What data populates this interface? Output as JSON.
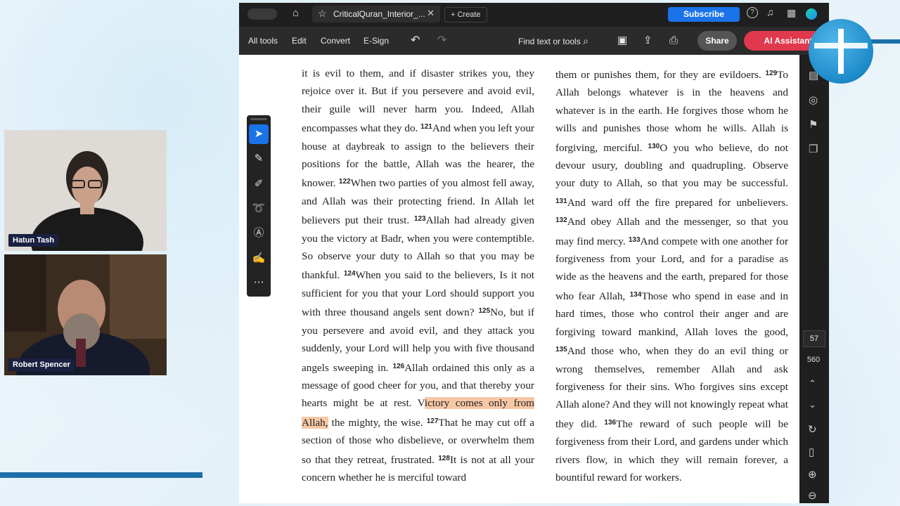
{
  "participants": [
    {
      "name": "Hatun Tash"
    },
    {
      "name": "Robert Spencer"
    }
  ],
  "titlebar": {
    "tab_title": "CriticalQuran_Interior_...",
    "create_label": "Create",
    "subscribe_label": "Subscribe"
  },
  "toolbar": {
    "all_tools": "All tools",
    "edit": "Edit",
    "convert": "Convert",
    "esign": "E-Sign",
    "find": "Find text or tools",
    "share": "Share",
    "ai_assistant": "AI Assistant"
  },
  "page_nav": {
    "current": "57",
    "total": "560"
  },
  "icons": [
    "home-icon",
    "star-icon",
    "close-icon",
    "plus-icon",
    "help-icon",
    "bell-icon",
    "apps-icon",
    "undo-icon",
    "redo-icon",
    "search-icon",
    "save-icon",
    "upload-icon",
    "print-icon",
    "select-icon",
    "comment-icon",
    "pen-icon",
    "lasso-icon",
    "text-select-icon",
    "stamp-icon",
    "more-icon",
    "refresh-icon",
    "zoom-in-icon",
    "zoom-out-icon",
    "chevron-up-icon",
    "chevron-down-icon",
    "page-icon"
  ],
  "colors": {
    "subscribe": "#1a73e8",
    "ai_button": "#e0384c",
    "highlight": "#f7c8a6",
    "accent_blue": "#1c6fa8"
  },
  "document": {
    "left_column": [
      {
        "n": "",
        "t": "it is evil to them, and if disaster strikes you, they rejoice over it. But if you persevere and avoid evil, their guile will never harm you. Indeed, Allah encompasses what they do."
      },
      {
        "n": "121",
        "t": "And when you left your house at daybreak to assign to the believers their positions for the battle, Allah was the hearer, the knower."
      },
      {
        "n": "122",
        "t": "When two parties of you almost fell away, and Allah was their protecting friend. In Allah let believers put their trust."
      },
      {
        "n": "123",
        "t": "Allah had already given you the victory at Badr, when you were contemptible. So observe your duty to Allah so that you may be thankful."
      },
      {
        "n": "124",
        "t": "When you said to the believers, Is it not sufficient for you that your Lord should support you with three thousand angels sent down?"
      },
      {
        "n": "125",
        "t": "No, but if you persevere and avoid evil, and they attack you suddenly, your Lord will help you with five thousand angels sweeping in."
      }
    ],
    "v126_pre": "Allah ordained this only as a message of good cheer for you, and that thereby your hearts might be at rest. V",
    "v126_highlight": "ictory comes only from Allah,",
    "v126_post": " the mighty, the wise.",
    "left_tail": [
      {
        "n": "127",
        "t": "That he may cut off a section of those who disbelieve, or overwhelm them so that they retreat, frustrated."
      },
      {
        "n": "128",
        "t": "It is not at all your concern whether he is merciful toward"
      }
    ],
    "right_column": [
      {
        "n": "",
        "t": "them or punishes them, for they are evildoers."
      },
      {
        "n": "129",
        "t": "To Allah belongs whatever is in the heavens and whatever is in the earth. He forgives those whom he wills and punishes those whom he wills. Allah is forgiving, merciful."
      },
      {
        "n": "130",
        "t": "O you who believe, do not devour usury, doubling and quadrupling. Observe your duty to Allah, so that you may be successful."
      },
      {
        "n": "131",
        "t": "And ward off the fire prepared for unbelievers."
      },
      {
        "n": "132",
        "t": "And obey Allah and the messenger, so that you may find mercy."
      },
      {
        "n": "133",
        "t": "And compete with one another for forgiveness from your Lord, and for a paradise as wide as the heavens and the earth, prepared for those who fear Allah,"
      },
      {
        "n": "134",
        "t": "Those who spend in ease and in hard times, those who control their anger and are forgiving toward mankind, Allah loves the good,"
      },
      {
        "n": "135",
        "t": "And those who, when they do an evil thing or wrong themselves, remember Allah and ask forgiveness for their sins. Who forgives sins except Allah alone? And they will not knowingly repeat what they did."
      },
      {
        "n": "136",
        "t": "The reward of such people will be forgiveness from their Lord, and gardens under which rivers flow, in which they will remain forever, a bountiful reward for workers."
      }
    ]
  }
}
